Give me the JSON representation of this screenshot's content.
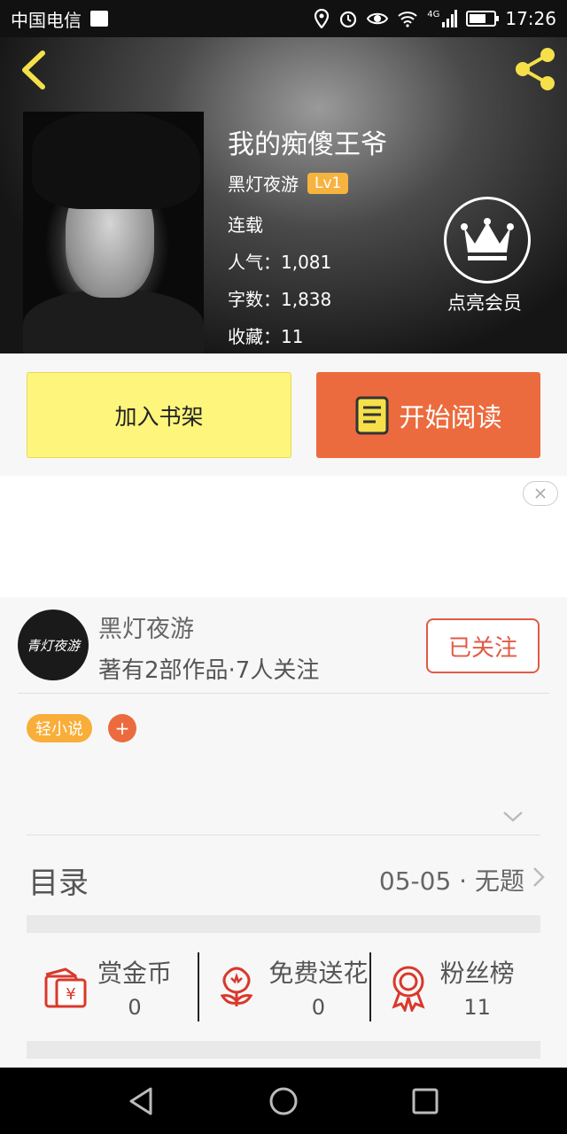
{
  "status_bar": {
    "carrier": "中国电信",
    "network": "4G",
    "time": "17:26"
  },
  "book": {
    "title": "我的痴傻王爷",
    "author": "黑灯夜游",
    "level": "Lv1",
    "status": "连载",
    "popularity": "人气：1,081",
    "word_count": "字数：1,838",
    "favorites": "收藏：11"
  },
  "vip": {
    "label": "点亮会员"
  },
  "actions": {
    "add_shelf": "加入书架",
    "start_read": "开始阅读"
  },
  "author_card": {
    "avatar_text": "青灯夜游",
    "name": "黑灯夜游",
    "stats": "著有2部作品·7人关注",
    "follow_label": "已关注"
  },
  "tags": [
    "轻小说"
  ],
  "tag_add": "+",
  "catalog": {
    "title": "目录",
    "latest": "05-05 · 无题"
  },
  "rewards": [
    {
      "label": "赏金币",
      "count": "0",
      "icon": "coin-envelope-icon"
    },
    {
      "label": "免费送花",
      "count": "0",
      "icon": "flower-icon"
    },
    {
      "label": "粉丝榜",
      "count": "11",
      "icon": "medal-icon"
    }
  ],
  "colors": {
    "accent_orange": "#ec6b3e",
    "shelf_yellow": "#fef57c",
    "badge_yellow": "#f6b33f",
    "icon_gold": "#f5e04a",
    "follow_red": "#e15a45"
  }
}
